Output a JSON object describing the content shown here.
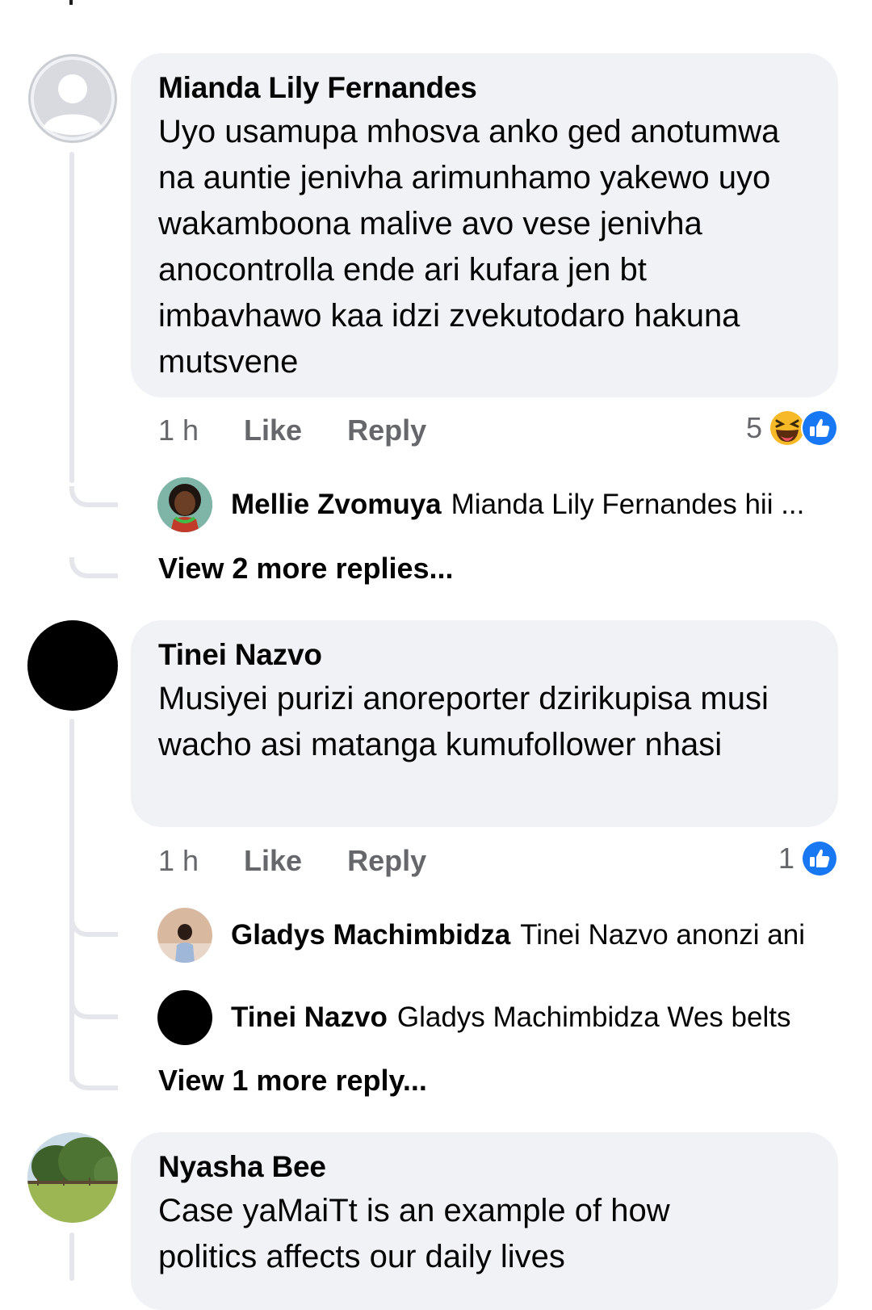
{
  "comments": [
    {
      "author": "Mianda Lily Fernandes",
      "text": "Uyo usamupa mhosva anko ged anotumwa na auntie jenivha arimunhamo yakewo uyo wakamboona malive avo vese jenivha anocontrolla ende ari kufara jen bt imbavhawo kaa idzi zvekutodaro hakuna mutsvene",
      "time": "1 h",
      "like_label": "Like",
      "reply_label": "Reply",
      "reaction_count": "5",
      "reaction_icons": [
        "laugh-reaction-icon",
        "like-reaction-icon"
      ],
      "avatar": "default-profile-icon",
      "replies": [
        {
          "author": "Mellie Zvomuya",
          "text": "Mianda Lily Fernandes  hii ..."
        }
      ],
      "view_more": "View 2 more replies..."
    },
    {
      "author": "Tinei Nazvo",
      "text": "Musiyei purizi anoreporter dzirikupisa musi wacho asi matanga kumufollower nhasi",
      "time": "1 h",
      "like_label": "Like",
      "reply_label": "Reply",
      "reaction_count": "1",
      "reaction_icons": [
        "like-reaction-icon"
      ],
      "avatar": "black-circle",
      "replies": [
        {
          "author": "Gladys Machimbidza",
          "text": "Tinei Nazvo anonzi ani"
        },
        {
          "author": "Tinei Nazvo",
          "text": "Gladys Machimbidza Wes belts"
        }
      ],
      "view_more": "View 1 more reply..."
    },
    {
      "author": "Nyasha Bee",
      "text": "Case yaMaiTt is an example of how politics affects our daily lives",
      "avatar": "landscape-photo"
    }
  ],
  "colors": {
    "bubble": "#f0f2f5",
    "meta_text": "#65676b",
    "like_blue": "#1877f2",
    "laugh_yellow": "#f7b928",
    "thread_line": "#e4e6eb"
  }
}
